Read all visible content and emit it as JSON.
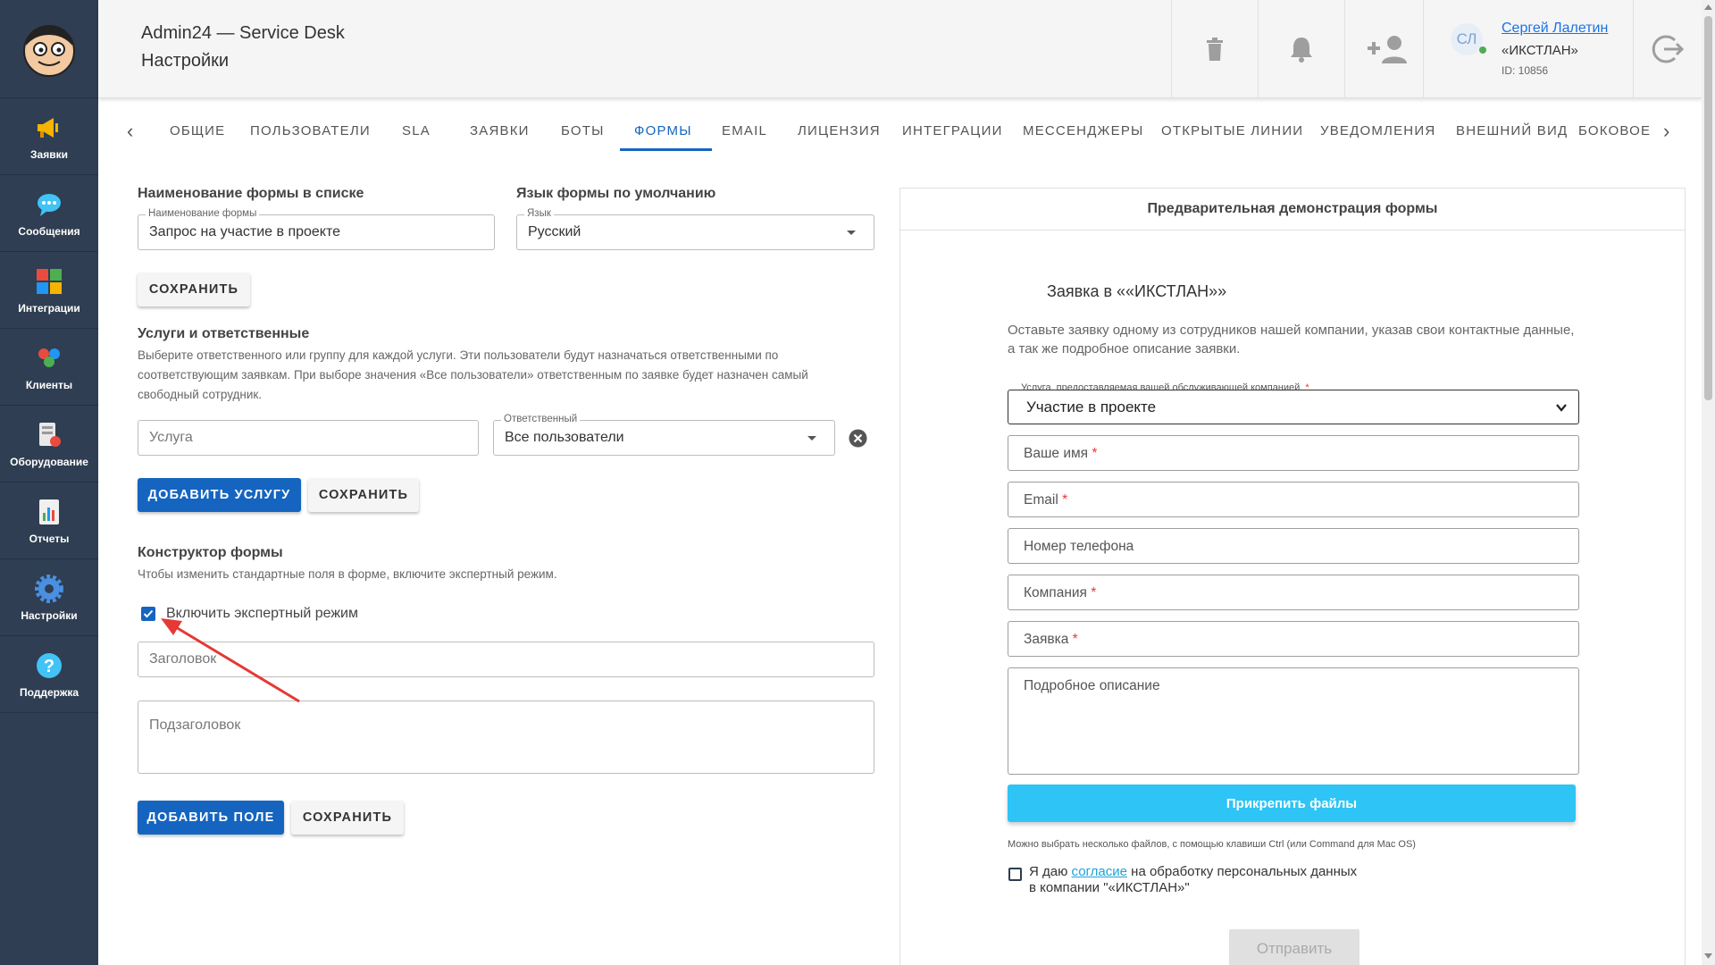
{
  "sidebar": {
    "items": [
      {
        "label": "Заявки",
        "icon": "megaphone-icon"
      },
      {
        "label": "Сообщения",
        "icon": "chat-bubbles-icon"
      },
      {
        "label": "Интеграции",
        "icon": "puzzle-icon"
      },
      {
        "label": "Клиенты",
        "icon": "people-icon"
      },
      {
        "label": "Оборудование",
        "icon": "equipment-icon"
      },
      {
        "label": "Отчеты",
        "icon": "report-icon"
      },
      {
        "label": "Настройки",
        "icon": "gear-icon"
      },
      {
        "label": "Поддержка",
        "icon": "help-icon"
      }
    ]
  },
  "header": {
    "app_title": "Admin24 — Service Desk",
    "page_title": "Настройки",
    "user": {
      "initials": "СЛ",
      "name": "Сергей Лалетин",
      "org": "«ИКСТЛАН»",
      "id": "ID: 10856"
    }
  },
  "tabs": [
    "Общие",
    "Пользователи",
    "SLA",
    "Заявки",
    "Боты",
    "Формы",
    "Email",
    "Лицензия",
    "Интеграции",
    "Мессенджеры",
    "Открытые линии",
    "Уведомления",
    "Внешний вид",
    "Боковое"
  ],
  "active_tab": "Формы",
  "form_settings": {
    "name_title": "Наименование формы в списке",
    "name_label": "Наименование формы",
    "name_value": "Запрос на участие в проекте",
    "lang_title": "Язык формы по умолчанию",
    "lang_label": "Язык",
    "lang_value": "Русский",
    "save": "Сохранить"
  },
  "services": {
    "title": "Услуги и ответственные",
    "description": "Выберите ответственного или группу для каждой услуги. Эти пользователи будут назначаться ответственными по соответствующим заявкам. При выборе значения «Все пользователи» ответственным по заявке будет назначен самый свободный сотрудник.",
    "service_placeholder": "Услуга",
    "responsible_label": "Ответственный",
    "responsible_value": "Все пользователи",
    "add": "Добавить услугу",
    "save": "Сохранить"
  },
  "constructor": {
    "title": "Конструктор формы",
    "description": "Чтобы изменить стандартные поля в форме, включите экспертный режим.",
    "expert_mode": "Включить экспертный режим",
    "expert_checked": true,
    "heading_placeholder": "Заголовок",
    "subheading_placeholder": "Подзаголовок",
    "add_field": "Добавить поле",
    "save": "Сохранить"
  },
  "preview": {
    "header": "Предварительная демонстрация формы",
    "title": "Заявка в ««ИКСТЛАН»»",
    "description": "Оставьте заявку одному из сотрудников нашей компании, указав свои контактные данные, а так же подробное описание заявки.",
    "service_label": "Услуга, предоставляемая вашей обслуживающей компанией.",
    "service_value": "Участие в проекте",
    "fields": [
      {
        "label": "Ваше имя",
        "required": "*"
      },
      {
        "label": "Email",
        "required": "*"
      },
      {
        "label": "Номер телефона",
        "required": ""
      },
      {
        "label": "Компания",
        "required": "*"
      },
      {
        "label": "Заявка",
        "required": "*"
      }
    ],
    "details_placeholder": "Подробное описание",
    "attach": "Прикрепить файлы",
    "hint": "Можно выбрать несколько файлов, с помощью клавиши Ctrl (или Command для Mac OS)",
    "consent_prefix": "Я даю",
    "consent_link": "согласие",
    "consent_suffix": "на обработку персональных данных",
    "consent_line2": "в компании \"«ИКСТЛАН»\"",
    "submit": "Отправить"
  },
  "colors": {
    "sidebar": "#2f3e52",
    "primary": "#1565c0",
    "attach": "#2ec4f5",
    "annotation": "#e53935"
  }
}
